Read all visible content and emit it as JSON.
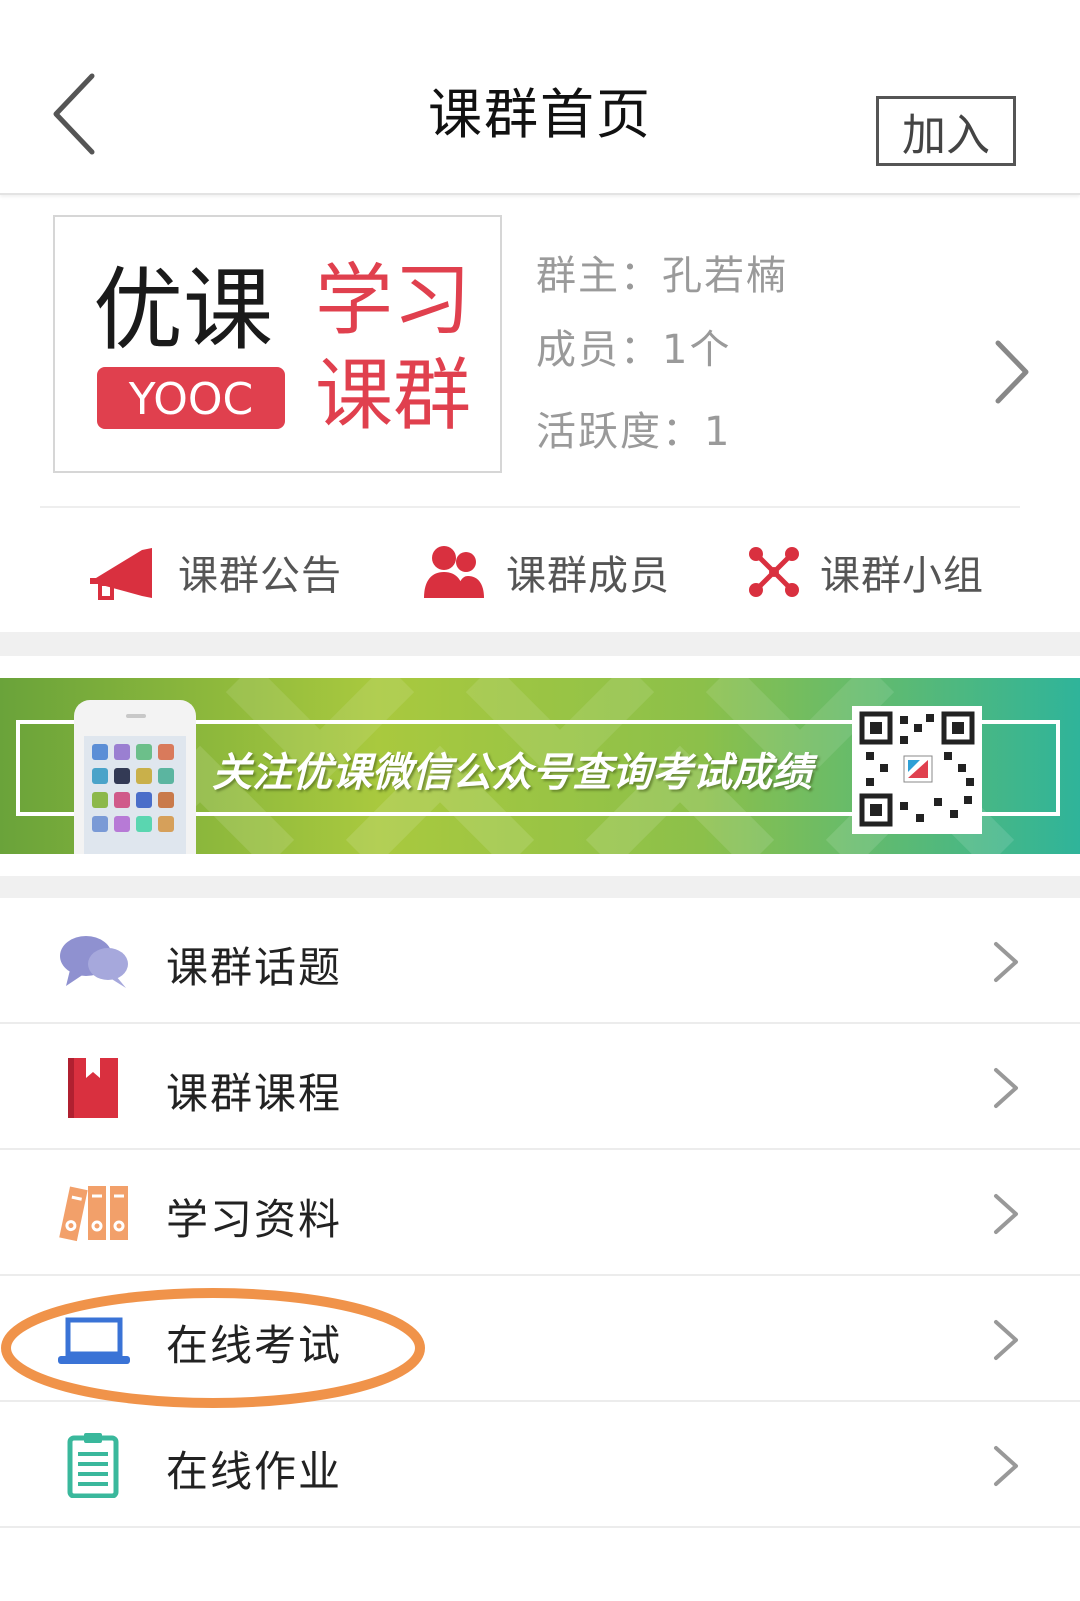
{
  "header": {
    "title": "课群首页",
    "join_label": "加入",
    "back_icon": "chevron-left-icon"
  },
  "group": {
    "logo": {
      "brand_cn": "优课",
      "brand_en": "YOOC",
      "title_line1": "学习",
      "title_line2": "课群",
      "brand_color": "#e0404e"
    },
    "owner_text": "群主：孔若楠",
    "members_text": "成员：1个",
    "activity_text": "活跃度：1"
  },
  "quick_actions": [
    {
      "label": "课群公告",
      "icon": "megaphone-icon"
    },
    {
      "label": "课群成员",
      "icon": "people-icon"
    },
    {
      "label": "课群小组",
      "icon": "network-icon"
    }
  ],
  "banner": {
    "text": "关注优课微信公众号查询考试成绩",
    "qr_icon": "qr-code-icon"
  },
  "menu": [
    {
      "label": "课群话题",
      "icon": "chat-bubbles-icon"
    },
    {
      "label": "课群课程",
      "icon": "book-icon"
    },
    {
      "label": "学习资料",
      "icon": "binders-icon"
    },
    {
      "label": "在线考试",
      "icon": "laptop-icon"
    },
    {
      "label": "在线作业",
      "icon": "clipboard-icon"
    }
  ],
  "colors": {
    "accent_red": "#e0404e",
    "highlight_orange": "#f0934a"
  }
}
